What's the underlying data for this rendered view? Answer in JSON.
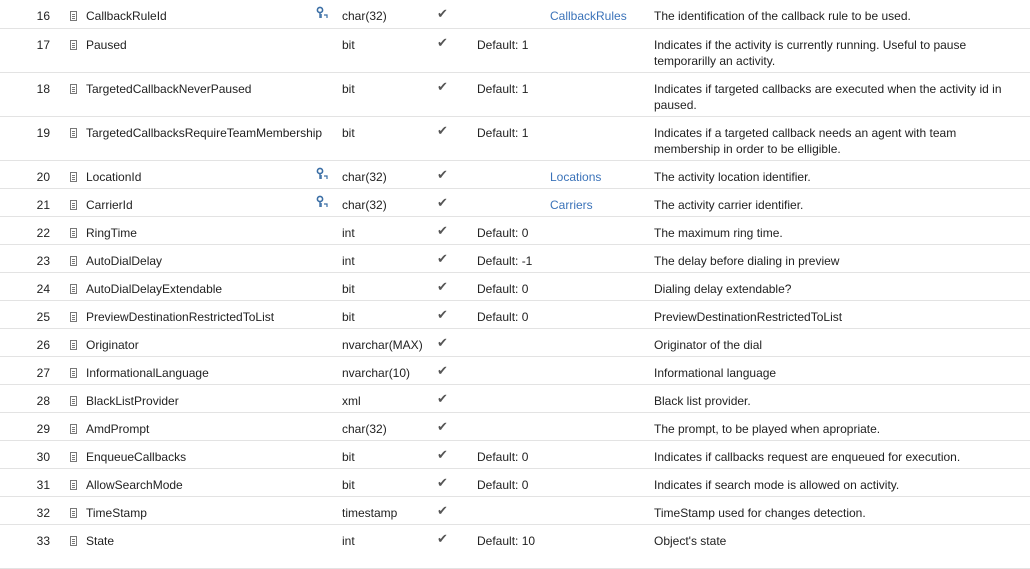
{
  "rows": [
    {
      "num": "16",
      "name": "CallbackRuleId",
      "key": true,
      "type": "char(32)",
      "check": "✔",
      "def": "",
      "fk": "CallbackRules",
      "desc": "The identification of the callback rule to be used."
    },
    {
      "num": "17",
      "name": "Paused",
      "key": false,
      "type": "bit",
      "check": "✔",
      "def": "Default: 1",
      "fk": "",
      "desc": "Indicates if the activity is currently running. Useful to pause temporarilly an activity."
    },
    {
      "num": "18",
      "name": "TargetedCallbackNeverPaused",
      "key": false,
      "type": "bit",
      "check": "✔",
      "def": "Default: 1",
      "fk": "",
      "desc": "Indicates if targeted callbacks are executed when the activity id in paused."
    },
    {
      "num": "19",
      "name": "TargetedCallbacksRequireTeamMembership",
      "key": false,
      "type": "bit",
      "check": "✔",
      "def": "Default: 1",
      "fk": "",
      "desc": "Indicates if a targeted callback needs an agent with team membership in order to be elligible."
    },
    {
      "num": "20",
      "name": "LocationId",
      "key": true,
      "type": "char(32)",
      "check": "✔",
      "def": "",
      "fk": "Locations",
      "desc": "The activity location identifier."
    },
    {
      "num": "21",
      "name": "CarrierId",
      "key": true,
      "type": "char(32)",
      "check": "✔",
      "def": "",
      "fk": "Carriers",
      "desc": "The activity carrier identifier."
    },
    {
      "num": "22",
      "name": "RingTime",
      "key": false,
      "type": "int",
      "check": "✔",
      "def": "Default: 0",
      "fk": "",
      "desc": "The maximum ring time."
    },
    {
      "num": "23",
      "name": "AutoDialDelay",
      "key": false,
      "type": "int",
      "check": "✔",
      "def": "Default: -1",
      "fk": "",
      "desc": "The delay before dialing in preview"
    },
    {
      "num": "24",
      "name": "AutoDialDelayExtendable",
      "key": false,
      "type": "bit",
      "check": "✔",
      "def": "Default: 0",
      "fk": "",
      "desc": "Dialing delay extendable?"
    },
    {
      "num": "25",
      "name": "PreviewDestinationRestrictedToList",
      "key": false,
      "type": "bit",
      "check": "✔",
      "def": "Default: 0",
      "fk": "",
      "desc": "PreviewDestinationRestrictedToList"
    },
    {
      "num": "26",
      "name": "Originator",
      "key": false,
      "type": "nvarchar(MAX)",
      "check": "✔",
      "def": "",
      "fk": "",
      "desc": "Originator of the dial"
    },
    {
      "num": "27",
      "name": "InformationalLanguage",
      "key": false,
      "type": "nvarchar(10)",
      "check": "✔",
      "def": "",
      "fk": "",
      "desc": "Informational language"
    },
    {
      "num": "28",
      "name": "BlackListProvider",
      "key": false,
      "type": "xml",
      "check": "✔",
      "def": "",
      "fk": "",
      "desc": "Black list provider."
    },
    {
      "num": "29",
      "name": "AmdPrompt",
      "key": false,
      "type": "char(32)",
      "check": "✔",
      "def": "",
      "fk": "",
      "desc": "The prompt, to be played when apropriate."
    },
    {
      "num": "30",
      "name": "EnqueueCallbacks",
      "key": false,
      "type": "bit",
      "check": "✔",
      "def": "Default: 0",
      "fk": "",
      "desc": "Indicates if callbacks request are enqueued for execution."
    },
    {
      "num": "31",
      "name": "AllowSearchMode",
      "key": false,
      "type": "bit",
      "check": "✔",
      "def": "Default: 0",
      "fk": "",
      "desc": "Indicates if search mode is allowed on activity."
    },
    {
      "num": "32",
      "name": "TimeStamp",
      "key": false,
      "type": "timestamp",
      "check": "✔",
      "def": "",
      "fk": "",
      "desc": "TimeStamp used for changes detection."
    },
    {
      "num": "33",
      "name": "State",
      "key": false,
      "type": "int",
      "check": "✔",
      "def": "Default: 10",
      "fk": "",
      "desc": "Object's state"
    }
  ],
  "row_heights": [
    28,
    44,
    44,
    44,
    28,
    28,
    28,
    28,
    28,
    28,
    28,
    28,
    28,
    28,
    28,
    28,
    28,
    44
  ]
}
